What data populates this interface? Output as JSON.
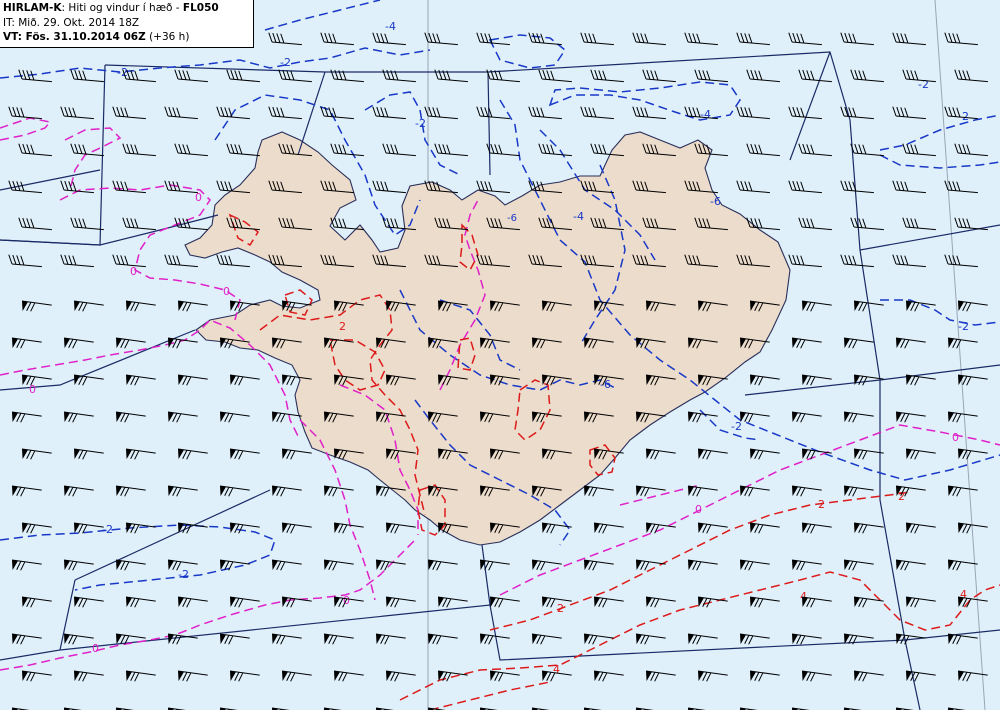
{
  "header": {
    "model": "HIRLAM-K",
    "title_text": ": Hiti og vindur í hæð - ",
    "level": "FL050",
    "it_line": "IT: Mið. 29. Okt. 2014 18Z",
    "vt_label": "VT: Fös. 31.10.2014 06Z",
    "vt_lead": "(+36 h)"
  },
  "colors": {
    "sea": "#dff0fa",
    "land": "#ecdccb",
    "coast": "#2a2f5a",
    "grid_lines": "#1a2a66",
    "meridian": "#9aa5b5",
    "negative_isotherm": "#1838c8",
    "zero_isotherm": "#e020c8",
    "positive_isotherm": "#dd1a1a",
    "wind_barb": "#000000"
  },
  "legend_items": {
    "blue_label_minus2": "-2",
    "blue_label_minus4": "-4",
    "blue_label_minus6": "-6",
    "magenta_label_zero": "0",
    "red_label_2": "2",
    "red_label_4": "4"
  },
  "wind_field": {
    "north_half_icon": "feathered-wind-barb-icon",
    "south_half_icon": "pennant-wind-barb-icon",
    "dominant_direction": "west-southwest"
  }
}
